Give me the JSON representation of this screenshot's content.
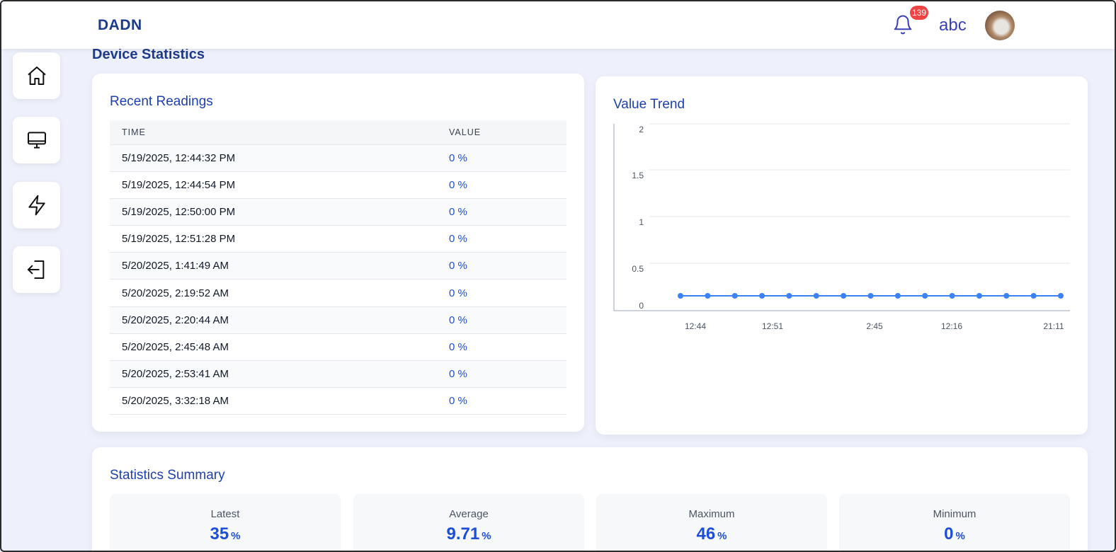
{
  "header": {
    "brand": "DADN",
    "notification_count": "139",
    "username": "abc"
  },
  "sidebar": {
    "items": [
      {
        "icon": "home-icon"
      },
      {
        "icon": "monitor-icon"
      },
      {
        "icon": "lightning-icon"
      },
      {
        "icon": "logout-icon"
      }
    ]
  },
  "page": {
    "title": "Device Statistics"
  },
  "readings": {
    "title": "Recent Readings",
    "columns": [
      "TIME",
      "VALUE"
    ],
    "rows": [
      {
        "time": "5/19/2025, 12:44:32 PM",
        "value": "0 %"
      },
      {
        "time": "5/19/2025, 12:44:54 PM",
        "value": "0 %"
      },
      {
        "time": "5/19/2025, 12:50:00 PM",
        "value": "0 %"
      },
      {
        "time": "5/19/2025, 12:51:28 PM",
        "value": "0 %"
      },
      {
        "time": "5/20/2025, 1:41:49 AM",
        "value": "0 %"
      },
      {
        "time": "5/20/2025, 2:19:52 AM",
        "value": "0 %"
      },
      {
        "time": "5/20/2025, 2:20:44 AM",
        "value": "0 %"
      },
      {
        "time": "5/20/2025, 2:45:48 AM",
        "value": "0 %"
      },
      {
        "time": "5/20/2025, 2:53:41 AM",
        "value": "0 %"
      },
      {
        "time": "5/20/2025, 3:32:18 AM",
        "value": "0 %"
      }
    ]
  },
  "trend": {
    "title": "Value Trend"
  },
  "chart_data": {
    "type": "line",
    "title": "Value Trend",
    "xlabel": "",
    "ylabel": "",
    "x_tick_labels": [
      "12:44",
      "12:51",
      "2:45",
      "12:16",
      "21:11"
    ],
    "y_ticks": [
      0,
      0.5,
      1,
      1.5,
      2
    ],
    "ylim": [
      0,
      2
    ],
    "grid": true,
    "series": [
      {
        "color": "#3b82f6",
        "values": [
          0,
          0,
          0,
          0,
          0,
          0,
          0,
          0,
          0,
          0,
          0,
          0,
          0,
          0,
          0
        ]
      }
    ]
  },
  "summary": {
    "title": "Statistics Summary",
    "stats": [
      {
        "label": "Latest",
        "value": "35",
        "unit": "%"
      },
      {
        "label": "Average",
        "value": "9.71",
        "unit": "%"
      },
      {
        "label": "Maximum",
        "value": "46",
        "unit": "%"
      },
      {
        "label": "Minimum",
        "value": "0",
        "unit": "%"
      }
    ]
  },
  "colors": {
    "accent": "#1d4ed8",
    "heading": "#1e3a8a",
    "badge": "#ef4444",
    "background": "#eef1fb"
  }
}
